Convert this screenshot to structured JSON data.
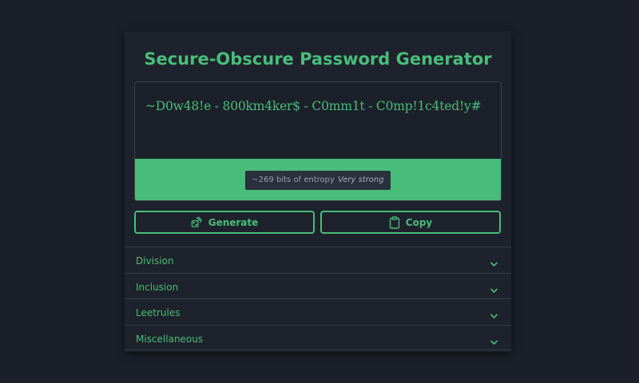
{
  "app": {
    "title": "Secure-Obscure Password Generator"
  },
  "output": {
    "password": "~D0w48!e - 800km4ker$ - C0mm1t - C0mp!1c4ted!y#",
    "entropy_text": "~269 bits of entropy",
    "strength_label": "Very strong",
    "strength_color": "#48bd7a"
  },
  "actions": {
    "generate_label": "Generate",
    "copy_label": "Copy",
    "generate_icon": "dice-icon",
    "copy_icon": "clipboard-icon"
  },
  "sections": [
    {
      "label": "Division"
    },
    {
      "label": "Inclusion"
    },
    {
      "label": "Leetrules"
    },
    {
      "label": "Miscellaneous"
    }
  ],
  "theme": {
    "accent": "#48bd7a",
    "background": "#1b1f29",
    "card": "#1e222c"
  }
}
